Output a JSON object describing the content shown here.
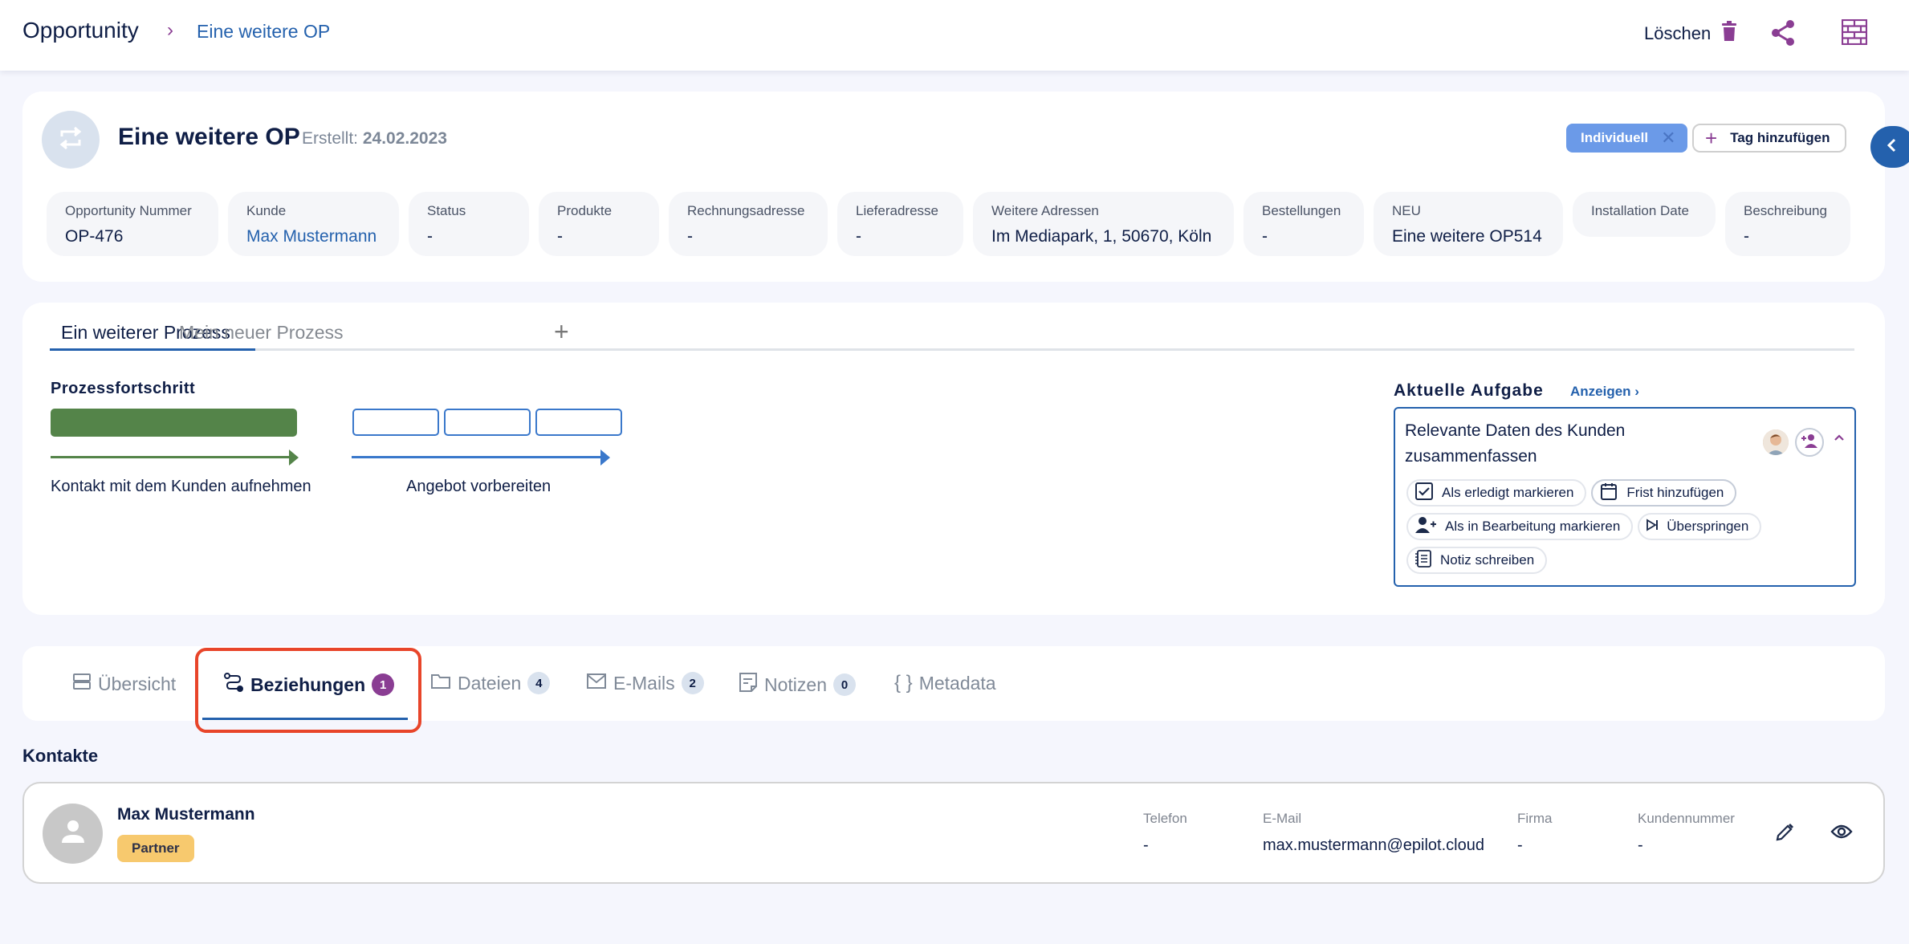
{
  "topbar": {
    "breadcrumb_root": "Opportunity",
    "breadcrumb_separator": "›",
    "breadcrumb_current": "Eine weitere OP",
    "delete_label": "Löschen",
    "delete_icon": "trash-icon",
    "share_icon": "share-icon",
    "layout_icon": "brick-wall-icon"
  },
  "header": {
    "entity_icon": "swap-arrows-icon",
    "title": "Eine weitere OP",
    "created_label": "Erstellt:",
    "created_date": "24.02.2023",
    "tags": [
      {
        "label": "Individuell",
        "color": "#6b9ae8"
      }
    ],
    "add_tag_label": "Tag hinzufügen",
    "attributes": [
      {
        "label": "Opportunity Nummer",
        "value": "OP-476"
      },
      {
        "label": "Kunde",
        "value": "Max Mustermann"
      },
      {
        "label": "Status",
        "value": "-"
      },
      {
        "label": "Produkte",
        "value": "-"
      },
      {
        "label": "Rechnungsadresse",
        "value": "-"
      },
      {
        "label": "Lieferadresse",
        "value": "-"
      },
      {
        "label": "Weitere Adressen",
        "value": "Im Mediapark, 1, 50670, Köln"
      },
      {
        "label": "Bestellungen",
        "value": "-"
      },
      {
        "label": "NEU",
        "value": "Eine weitere OP514"
      },
      {
        "label": "Installation Date",
        "value": ""
      },
      {
        "label": "Beschreibung",
        "value": "-"
      }
    ]
  },
  "process": {
    "tabs": [
      {
        "label": "Ein weiterer Prozess",
        "active": true
      },
      {
        "label": "Mein neuer Prozess",
        "active": false
      }
    ],
    "add_tab_label": "+",
    "progress_title": "Prozessfortschritt",
    "phases": [
      {
        "label": "Kontakt mit dem Kunden aufnehmen",
        "status": "done",
        "steps_done": 1,
        "steps_total": 1
      },
      {
        "label": "Angebot vorbereiten",
        "status": "open",
        "steps_done": 0,
        "steps_total": 3
      }
    ],
    "current_task": {
      "heading": "Aktuelle Aufgabe",
      "show_label": "Anzeigen",
      "name": "Relevante Daten des Kunden zusammenfassen",
      "actions": [
        {
          "label": "Als erledigt markieren",
          "icon": "checkbox-icon"
        },
        {
          "label": "Frist hinzufügen",
          "icon": "calendar-icon"
        },
        {
          "label": "Als in Bearbeitung markieren",
          "icon": "person-add-icon"
        },
        {
          "label": "Überspringen",
          "icon": "skip-icon"
        },
        {
          "label": "Notiz schreiben",
          "icon": "notebook-icon"
        }
      ]
    }
  },
  "record_tabs": [
    {
      "label": "Übersicht",
      "icon": "overview-icon",
      "count": null,
      "active": false
    },
    {
      "label": "Beziehungen",
      "icon": "relations-icon",
      "count": "1",
      "active": true
    },
    {
      "label": "Dateien",
      "icon": "folder-icon",
      "count": "4",
      "active": false
    },
    {
      "label": "E-Mails",
      "icon": "mail-icon",
      "count": "2",
      "active": false
    },
    {
      "label": "Notizen",
      "icon": "note-icon",
      "count": "0",
      "active": false
    },
    {
      "label": "Metadata",
      "icon": "braces-icon",
      "count": null,
      "active": false
    }
  ],
  "contacts": {
    "title": "Kontakte",
    "items": [
      {
        "name": "Max Mustermann",
        "tag": "Partner",
        "fields": [
          {
            "label": "Telefon",
            "value": "-"
          },
          {
            "label": "E-Mail",
            "value": "max.mustermann@epilot.cloud"
          },
          {
            "label": "Firma",
            "value": "-"
          },
          {
            "label": "Kundennummer",
            "value": "-"
          }
        ]
      }
    ]
  },
  "colors": {
    "brand_blue": "#2461ad",
    "accent_purple": "#8a3d93",
    "done_green": "#548449",
    "highlight_red": "#e8452a",
    "partner_tag": "#f7c96e"
  }
}
